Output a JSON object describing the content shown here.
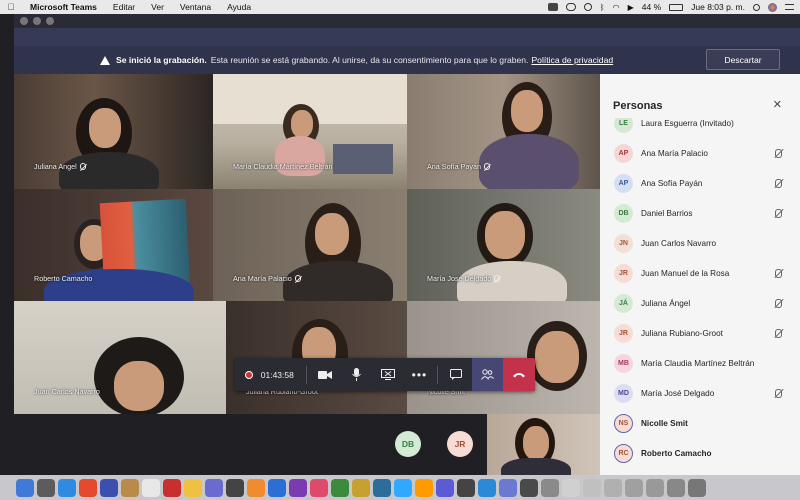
{
  "menubar": {
    "app": "Microsoft Teams",
    "items": [
      "Editar",
      "Ver",
      "Ventana",
      "Ayuda"
    ],
    "battery": "44 %",
    "clock": "Jue 8:03 p. m."
  },
  "banner": {
    "title": "Se inició la grabación.",
    "message": "Esta reunión se está grabando. Al unirse, da su consentimiento para que lo graben.",
    "link": "Política de privacidad",
    "discard": "Descartar"
  },
  "tiles": [
    {
      "name": "Juliana Angel"
    },
    {
      "name": "María Claudia Martínez Beltrán"
    },
    {
      "name": "Ana Sofía Payán"
    },
    {
      "name": "Roberto Camacho"
    },
    {
      "name": "Ana María Palacio"
    },
    {
      "name": "María José Delgado"
    },
    {
      "name": "Juan Carlos Navarro"
    },
    {
      "name": "Juliana Rubiano-Groot"
    },
    {
      "name": "Nicolle Smit"
    }
  ],
  "controls": {
    "timer": "01:43:58"
  },
  "panel": {
    "title": "Personas",
    "people": [
      {
        "initials": "LE",
        "name": "Laura Esguerra (Invitado)",
        "muted": false,
        "bold": false,
        "bg": "#d5e8d4",
        "fg": "#3a7d44"
      },
      {
        "initials": "AP",
        "name": "Ana María Palacio",
        "muted": true,
        "bold": false,
        "bg": "#f6d5d5",
        "fg": "#a4373a"
      },
      {
        "initials": "AP",
        "name": "Ana Sofía Payán",
        "muted": true,
        "bold": false,
        "bg": "#d4dff3",
        "fg": "#3b5998"
      },
      {
        "initials": "DB",
        "name": "Daniel Barrios",
        "muted": true,
        "bold": false,
        "bg": "#d5ead4",
        "fg": "#3a7d44"
      },
      {
        "initials": "JN",
        "name": "Juan Carlos Navarro",
        "muted": false,
        "bold": false,
        "bg": "#f3dfd4",
        "fg": "#9a5a3a"
      },
      {
        "initials": "JR",
        "name": "Juan Manuel de la Rosa",
        "muted": true,
        "bold": false,
        "bg": "#f6dcd4",
        "fg": "#a4503a"
      },
      {
        "initials": "JÁ",
        "name": "Juliana Ángel",
        "muted": true,
        "bold": false,
        "bg": "#d5ead4",
        "fg": "#3a7d44"
      },
      {
        "initials": "JR",
        "name": "Juliana Rubiano-Groot",
        "muted": true,
        "bold": false,
        "bg": "#f6dcd4",
        "fg": "#a4503a"
      },
      {
        "initials": "MB",
        "name": "María Claudia Martínez Beltrán",
        "muted": false,
        "bold": false,
        "bg": "#f6d5e0",
        "fg": "#a43a6a"
      },
      {
        "initials": "MD",
        "name": "María José Delgado",
        "muted": true,
        "bold": false,
        "bg": "#dcdcf3",
        "fg": "#4a4a98"
      },
      {
        "initials": "NS",
        "name": "Nicolle Smit",
        "muted": false,
        "bold": true,
        "bg": "#f6dcd4",
        "fg": "#a4503a"
      },
      {
        "initials": "RC",
        "name": "Roberto Camacho",
        "muted": false,
        "bold": true,
        "bg": "#f6dcd4",
        "fg": "#a4503a"
      }
    ]
  },
  "bottom_avatars": [
    {
      "initials": "DB",
      "bg": "#d5ead4",
      "fg": "#3a7d44"
    },
    {
      "initials": "JR",
      "bg": "#f6dcd4",
      "fg": "#a4503a"
    }
  ],
  "colors": {
    "teams_purple": "#464775",
    "hangup_red": "#c4314b",
    "recording_red": "#d13438",
    "banner_bg": "#30334c"
  }
}
